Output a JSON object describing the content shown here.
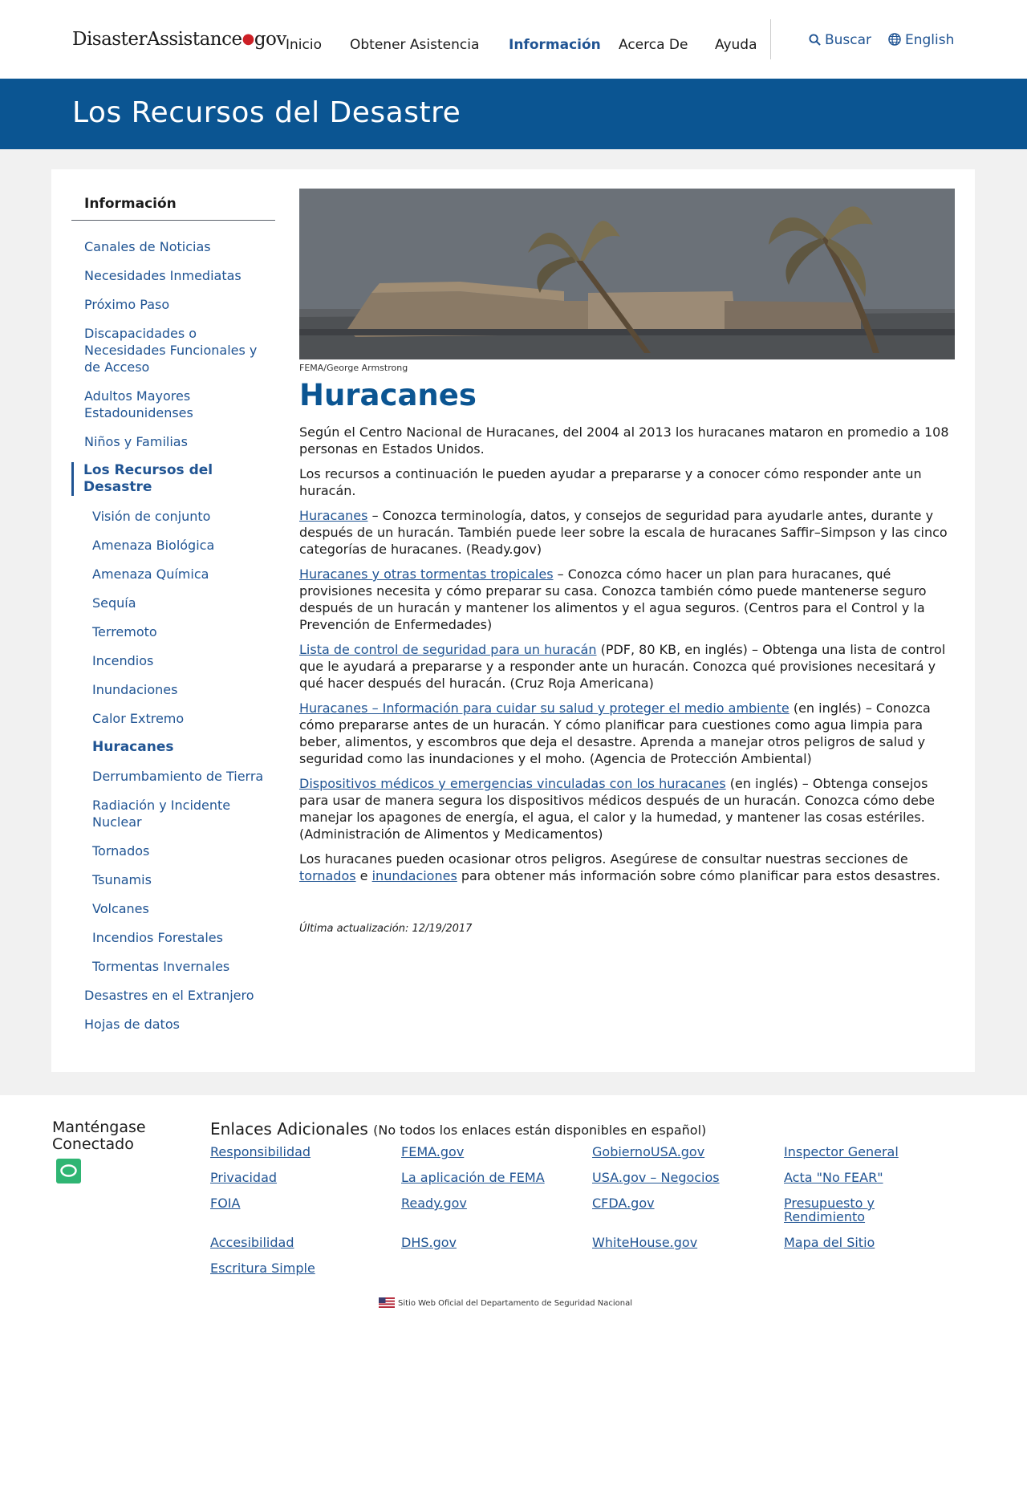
{
  "header": {
    "logo": {
      "part1": "DisasterAssistance",
      "part2": "gov"
    },
    "nav": [
      "Inicio",
      "Obtener Asistencia",
      "Información",
      "Acerca De",
      "Ayuda"
    ],
    "search_label": "Buscar",
    "language_label": "English",
    "colors": {
      "primary": "#0b5592",
      "link": "#205493",
      "logo_dot": "#cd2026"
    }
  },
  "banner": {
    "title": "Los Recursos del Desastre"
  },
  "sidebar": {
    "title": "Información",
    "items": [
      {
        "label": "Canales de Noticias"
      },
      {
        "label": "Necesidades Inmediatas"
      },
      {
        "label": "Próximo Paso"
      },
      {
        "label": "Discapacidades o Necesidades Funcionales y de Acceso"
      },
      {
        "label": "Adultos Mayores Estadounidenses"
      },
      {
        "label": "Niños y Familias"
      },
      {
        "label": "Los Recursos del Desastre"
      },
      {
        "label": "Visión de conjunto"
      },
      {
        "label": "Amenaza Biológica"
      },
      {
        "label": "Amenaza Química"
      },
      {
        "label": "Sequía"
      },
      {
        "label": "Terremoto"
      },
      {
        "label": "Incendios"
      },
      {
        "label": "Inundaciones"
      },
      {
        "label": "Calor Extremo"
      },
      {
        "label": "Huracanes"
      },
      {
        "label": "Derrumbamiento de Tierra"
      },
      {
        "label": "Radiación y Incidente Nuclear"
      },
      {
        "label": "Tornados"
      },
      {
        "label": "Tsunamis"
      },
      {
        "label": "Volcanes"
      },
      {
        "label": "Incendios Forestales"
      },
      {
        "label": "Tormentas Invernales"
      },
      {
        "label": "Desastres en el Extranjero"
      },
      {
        "label": "Hojas de datos"
      }
    ]
  },
  "content": {
    "image_credit": "FEMA/George Armstrong",
    "heading": "Huracanes",
    "intro1": "Según el Centro Nacional de Huracanes, del 2004 al 2013 los huracanes mataron en promedio a 108 personas en Estados Unidos.",
    "intro2": "Los recursos a continuación le pueden ayudar a prepararse y a conocer cómo responder ante un huracán.",
    "resources": [
      {
        "link": "Huracanes",
        "text": " – Conozca terminología, datos, y consejos de seguridad para ayudarle antes, durante y después de un huracán. También puede leer sobre la escala de huracanes Saffir–Simpson y las cinco categorías de huracanes. (Ready.gov)"
      },
      {
        "link": "Huracanes y otras tormentas tropicales",
        "text": " – Conozca cómo hacer un plan para huracanes, qué provisiones necesita y cómo preparar su casa. Conozca también cómo puede mantenerse seguro después de un huracán y mantener los alimentos y el agua seguros. (Centros para el Control y la Prevención de Enfermedades)"
      },
      {
        "link": "Lista de control de seguridad para un huracán",
        "text": " (PDF, 80 KB, en inglés) – Obtenga una lista de control que le ayudará a prepararse y a responder ante un huracán. Conozca qué provisiones necesitará y qué hacer después del huracán. (Cruz Roja Americana)"
      },
      {
        "link": "Huracanes – Información para cuidar su salud y proteger el medio ambiente",
        "text": " (en inglés) – Conozca cómo prepararse antes de un huracán. Y cómo planificar para cuestiones como agua limpia para beber, alimentos, y escombros que deja el desastre. Aprenda a manejar otros peligros de salud y seguridad como las inundaciones y el moho. (Agencia de Protección Ambiental)"
      },
      {
        "link": "Dispositivos médicos y emergencias vinculadas con los huracanes",
        "text": " (en inglés) – Obtenga consejos para usar de manera segura los dispositivos médicos después de un huracán. Conozca cómo debe manejar los apagones de energía, el agua, el calor y la humedad, y mantener las cosas estériles. (Administración de Alimentos y Medicamentos)"
      }
    ],
    "closing": {
      "before": "Los huracanes pueden ocasionar otros peligros. Asegúrese de consultar nuestras secciones de ",
      "link1": "tornados",
      "middle": " e ",
      "link2": "inundaciones",
      "after": " para obtener más información sobre cómo planificar para estos desastres."
    },
    "updated": "Última actualización: 12/19/2017"
  },
  "footer": {
    "stay_connected": "Manténgase Conectado",
    "links_title": "Enlaces Adicionales",
    "links_note": "(No todos los enlaces están disponibles en español)",
    "links": [
      "Responsibilidad",
      "FEMA.gov",
      "GobiernoUSA.gov",
      "Inspector General",
      "Privacidad",
      "La aplicación de FEMA",
      "USA.gov – Negocios",
      "Acta \"No FEAR\"",
      "FOIA",
      "Ready.gov",
      "CFDA.gov",
      "Presupuesto y Rendimiento",
      "Accesibilidad",
      "DHS.gov",
      "WhiteHouse.gov",
      "Mapa del Sitio",
      "Escritura Simple"
    ],
    "official_notice": "Sitio Web Oficial del Departamento de Seguridad Nacional"
  }
}
